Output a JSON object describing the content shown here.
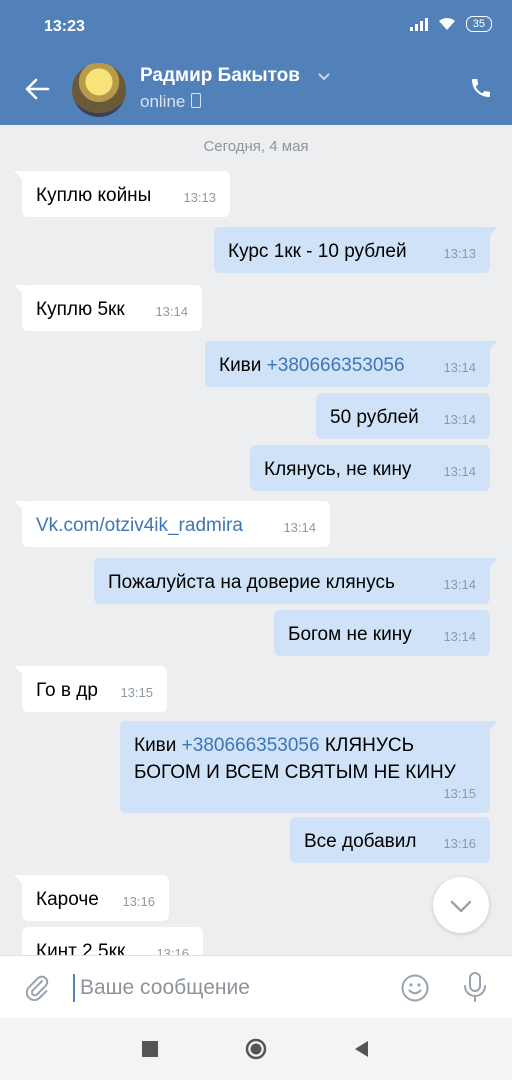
{
  "status_bar": {
    "time": "13:23",
    "battery": "35"
  },
  "header": {
    "contact_name": "Радмир Бакытов",
    "status": "online"
  },
  "chat": {
    "date_separator": "Сегодня, 4 мая",
    "messages": [
      {
        "dir": "in",
        "text": "Куплю койны",
        "time": "13:13"
      },
      {
        "dir": "out",
        "text": "Курс 1кк - 10 рублей",
        "time": "13:13"
      },
      {
        "dir": "in",
        "text": "Куплю 5кк",
        "time": "13:14"
      },
      {
        "dir": "out",
        "text_prefix": "Киви ",
        "phone": "+380666353056",
        "time": "13:14"
      },
      {
        "dir": "out",
        "text": "50 рублей",
        "time": "13:14"
      },
      {
        "dir": "out",
        "text": "Клянусь, не кину",
        "time": "13:14"
      },
      {
        "dir": "in",
        "link": "Vk.com/otziv4ik_radmira",
        "time": "13:14"
      },
      {
        "dir": "out",
        "text": "Пожалуйста на доверие клянусь",
        "time": "13:14"
      },
      {
        "dir": "out",
        "text": "Богом не кину",
        "time": "13:14"
      },
      {
        "dir": "in",
        "text": "Го в др",
        "time": "13:15"
      },
      {
        "dir": "out",
        "text_prefix": "Киви ",
        "phone": "+380666353056",
        "text_suffix": " КЛЯНУСЬ",
        "text_line2": "БОГОМ И ВСЕМ СВЯТЫМ НЕ КИНУ",
        "time": "13:15"
      },
      {
        "dir": "out",
        "text": "Все добавил",
        "time": "13:16"
      },
      {
        "dir": "in",
        "text": "Кароче",
        "time": "13:16"
      },
      {
        "dir": "in",
        "text": "Кинт 2.5кк",
        "time": "13:16"
      }
    ]
  },
  "input": {
    "placeholder": "Ваше сообщение"
  },
  "icons": {
    "back": "arrow-left",
    "phone": "phone",
    "attach": "paperclip",
    "emoji": "smile",
    "mic": "microphone",
    "scroll": "chevron-down"
  },
  "colors": {
    "header": "#5181b8",
    "bubble_out": "#cfe2f7",
    "bubble_in": "#ffffff",
    "link": "#3e76b5",
    "background": "#edeef0"
  }
}
